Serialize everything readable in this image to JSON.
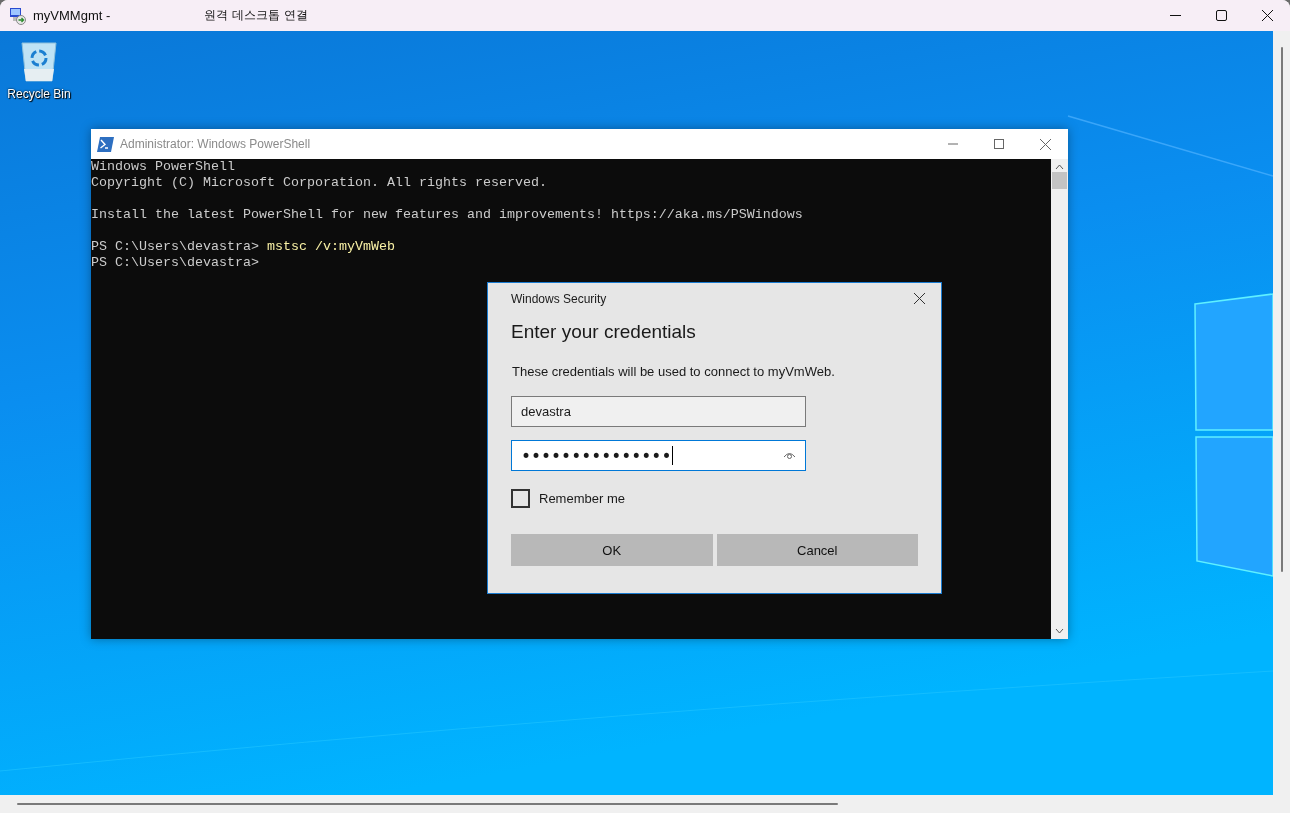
{
  "window": {
    "title": "myVMMgmt -",
    "subtitle": "원격 데스크톱 연결"
  },
  "desktop": {
    "icons": [
      {
        "label": "Recycle Bin"
      }
    ]
  },
  "powershell": {
    "title": "Administrator: Windows PowerShell",
    "lines": [
      {
        "kind": "output",
        "text": "Windows PowerShell"
      },
      {
        "kind": "output",
        "text": "Copyright (C) Microsoft Corporation. All rights reserved."
      },
      {
        "kind": "blank"
      },
      {
        "kind": "output",
        "text": "Install the latest PowerShell for new features and improvements! https://aka.ms/PSWindows"
      },
      {
        "kind": "blank"
      },
      {
        "kind": "prompt",
        "text": "PS C:\\Users\\devastra>",
        "command": "mstsc /v:myVmWeb"
      },
      {
        "kind": "prompt",
        "text": "PS C:\\Users\\devastra>"
      }
    ]
  },
  "dialog": {
    "title": "Windows Security",
    "heading": "Enter your credentials",
    "message": "These credentials will be used to connect to myVmWeb.",
    "username": {
      "value": "devastra",
      "focused": false
    },
    "password": {
      "value": "•••••••••••••••",
      "focused": true
    },
    "remember": {
      "label": "Remember me",
      "checked": false
    },
    "buttons": [
      "OK",
      "Cancel"
    ]
  }
}
